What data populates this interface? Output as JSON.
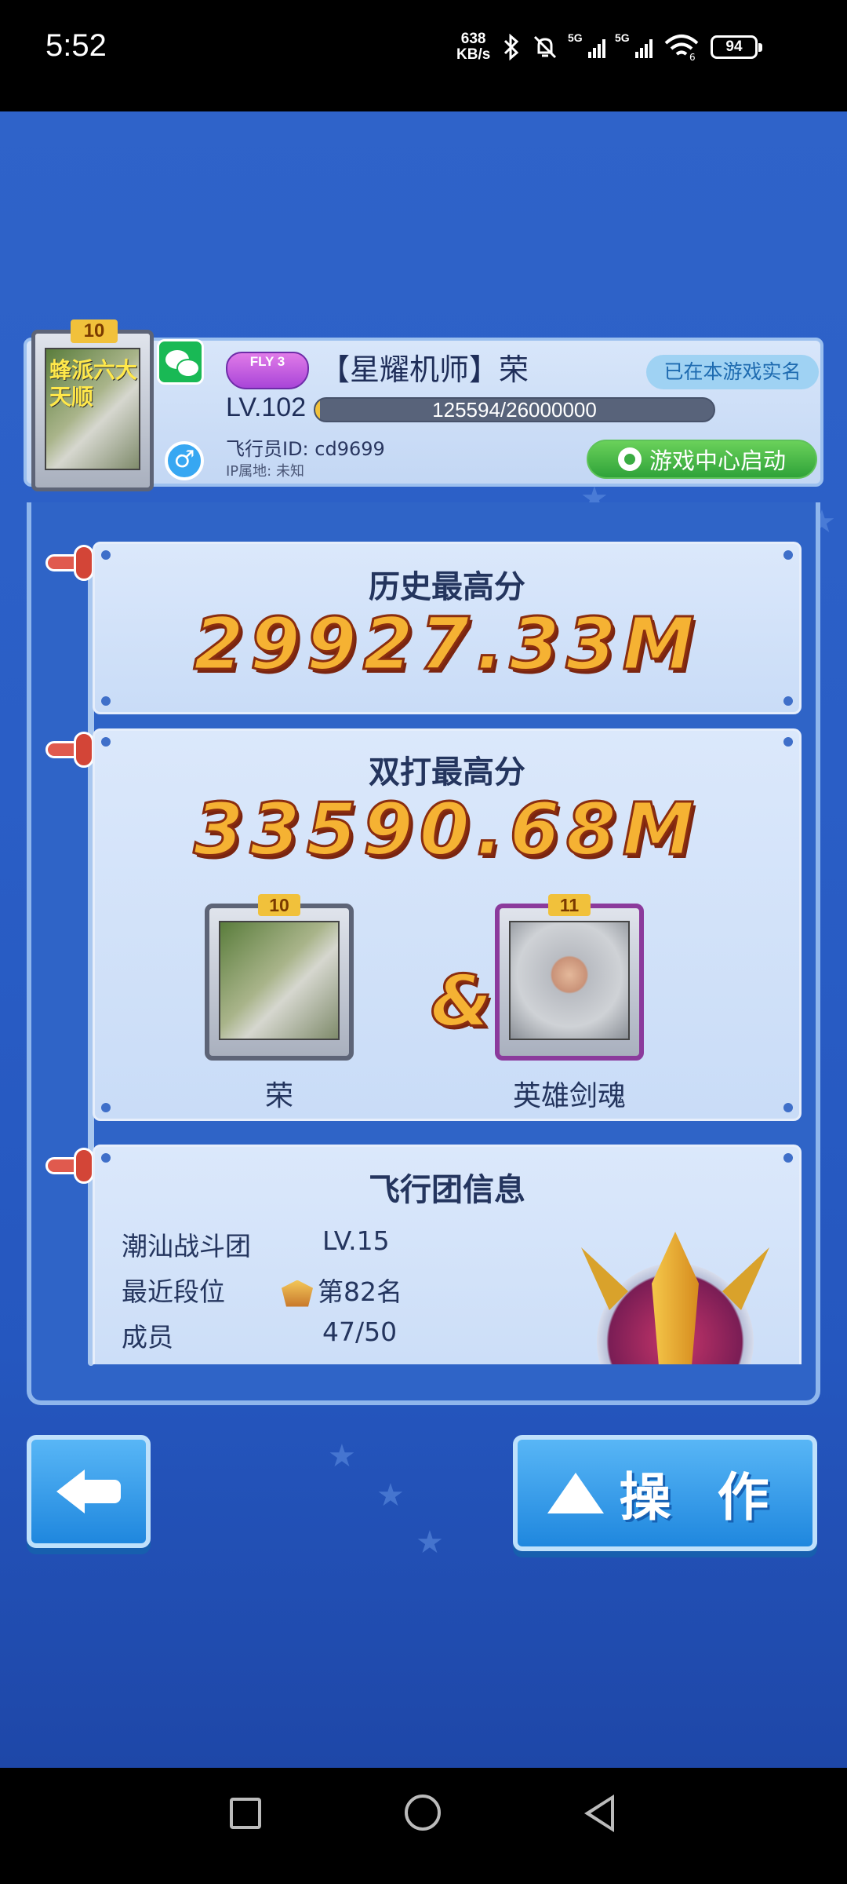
{
  "status_bar": {
    "time": "5:52",
    "net_speed_value": "638",
    "net_speed_unit": "KB/s",
    "signal1_label": "5G",
    "signal2_label": "5G",
    "battery": "94"
  },
  "profile": {
    "avatar_level": "10",
    "avatar_caption": "蜂派六大天顺",
    "fly_badge": "FLY 3",
    "name": "【星耀机师】荣",
    "verify_tag": "已在本游戏实名",
    "level": "LV.102",
    "exp": "125594/26000000",
    "exp_fraction": 0.0048,
    "pilot_id": "飞行员ID: cd9699",
    "ip_location": "IP属地:  未知",
    "game_center_button": "游戏中心启动"
  },
  "history_card": {
    "title": "历史最高分",
    "score": "29927.33M"
  },
  "duo_card": {
    "title": "双打最高分",
    "score": "33590.68M",
    "ampersand": "&",
    "player1": {
      "level": "10",
      "name": "荣"
    },
    "player2": {
      "level": "11",
      "name": "英雄剑魂"
    }
  },
  "team_card": {
    "title": "飞行团信息",
    "rows": [
      {
        "label": "潮汕战斗团",
        "value": "LV.15"
      },
      {
        "label": "最近段位",
        "value": "第82名"
      },
      {
        "label": "成员",
        "value": "47/50"
      }
    ]
  },
  "buttons": {
    "operate": "操 作"
  },
  "colors": {
    "background": "#2a5ec6",
    "score_gold": "#f5b233",
    "button_blue": "#1f87de"
  }
}
